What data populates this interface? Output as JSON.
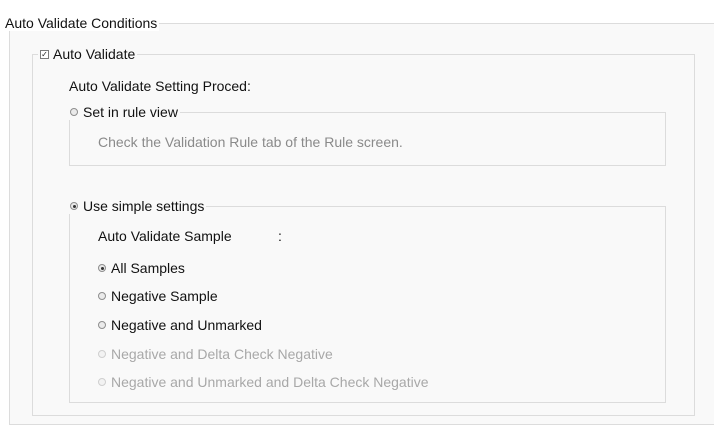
{
  "group": {
    "title": "Auto Validate Conditions"
  },
  "auto_validate": {
    "checkbox_label": "Auto Validate",
    "checked": true,
    "setting_proc_label": "Auto Validate Setting Proced:",
    "rule_view": {
      "label": "Set in rule view",
      "selected": false,
      "description": "Check the Validation Rule tab of the Rule screen."
    },
    "simple": {
      "label": "Use simple settings",
      "selected": true,
      "sample_label": "Auto Validate Sample",
      "sample_colon": ":",
      "options": [
        {
          "label": "All Samples",
          "selected": true,
          "enabled": true
        },
        {
          "label": "Negative Sample",
          "selected": false,
          "enabled": true
        },
        {
          "label": "Negative and Unmarked",
          "selected": false,
          "enabled": true
        },
        {
          "label": "Negative and Delta Check Negative",
          "selected": false,
          "enabled": false
        },
        {
          "label": "Negative and Unmarked and Delta Check Negative",
          "selected": false,
          "enabled": false
        }
      ]
    }
  },
  "colors": {
    "frame_border": "#dcdcdc",
    "frame_bg": "#f9f9f9",
    "disabled_text": "#a8a8a8"
  }
}
